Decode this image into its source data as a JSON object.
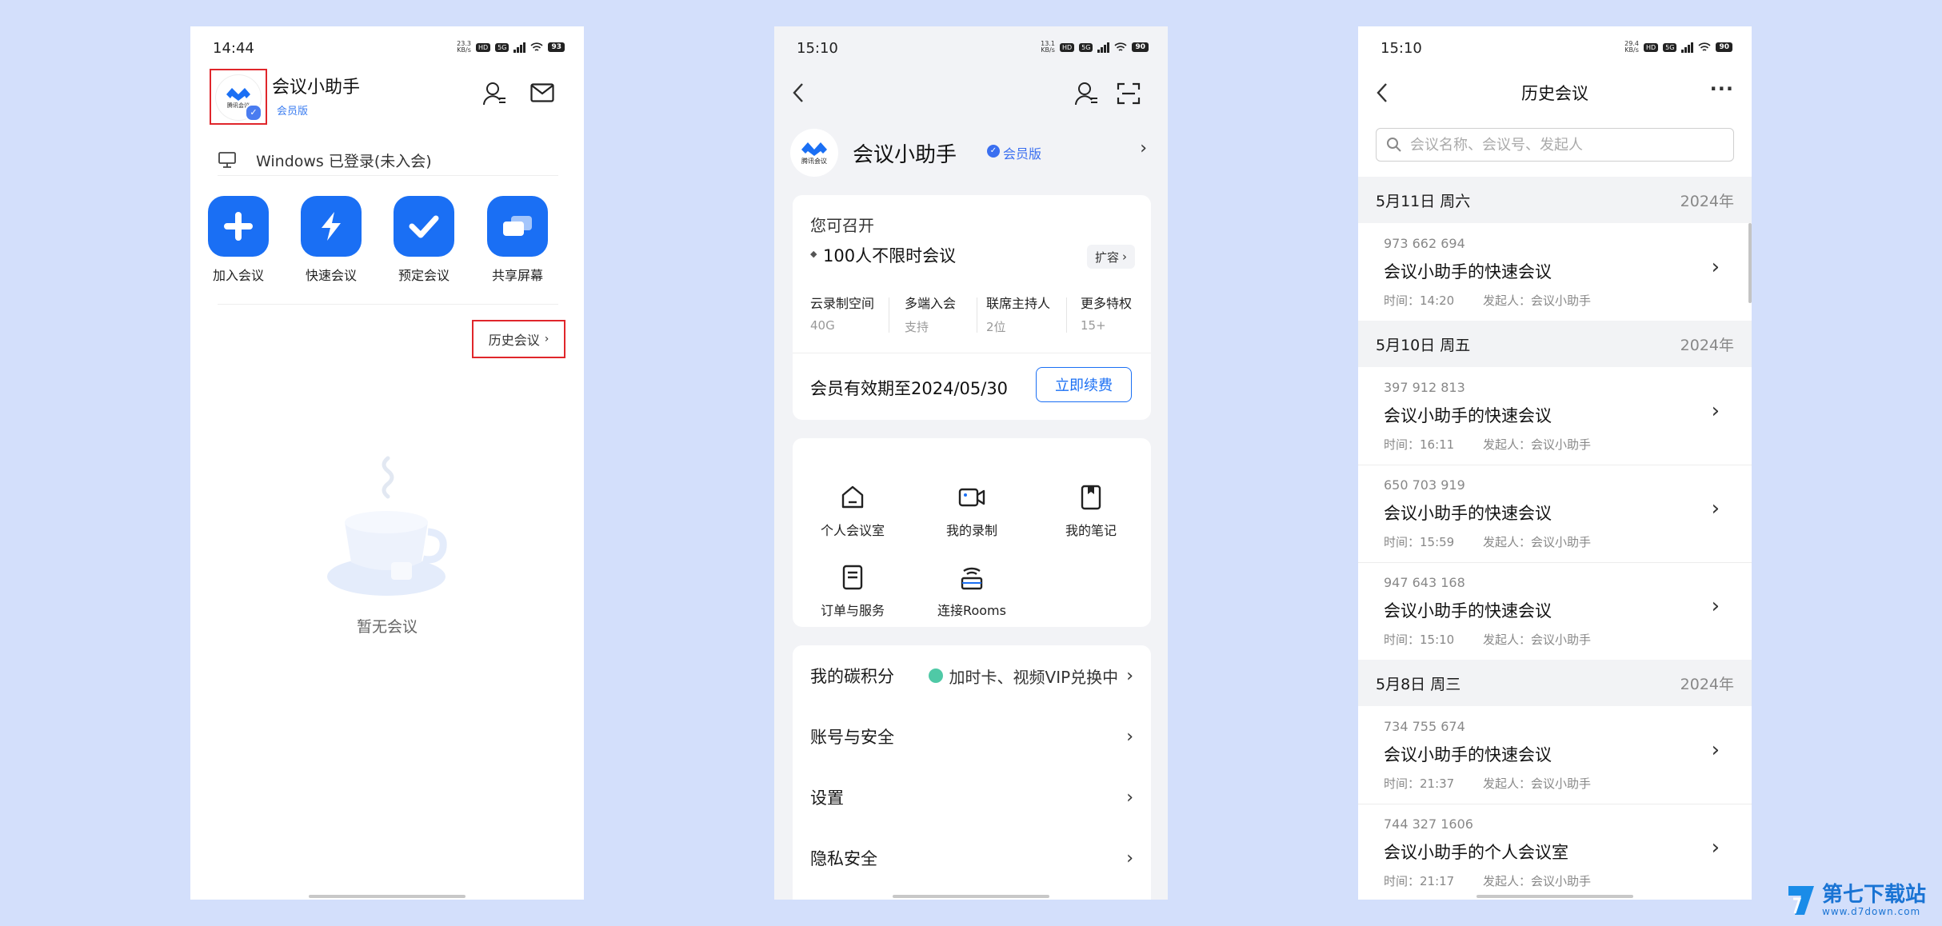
{
  "panel1": {
    "status": {
      "time": "14:44",
      "speed": "23.3\nKB/s",
      "hd": "HD",
      "net": "5G",
      "battery": "93"
    },
    "app_title": "会议小助手",
    "member_badge": "会员版",
    "logo_text": "腾讯会议",
    "device_status": "Windows 已登录(未入会)",
    "quick_actions": [
      {
        "label": "加入会议",
        "icon": "plus-icon"
      },
      {
        "label": "快速会议",
        "icon": "lightning-icon"
      },
      {
        "label": "预定会议",
        "icon": "check-icon"
      },
      {
        "label": "共享屏幕",
        "icon": "share-screen-icon"
      }
    ],
    "history_link": "历史会议",
    "empty_text": "暂无会议"
  },
  "panel2": {
    "status": {
      "time": "15:10",
      "speed": "13.1\nKB/s",
      "hd": "HD",
      "net": "5G",
      "battery": "90"
    },
    "profile_name": "会议小助手",
    "member_badge": "会员版",
    "logo_text": "腾讯会议",
    "plan": {
      "heading": "您可召开",
      "main": "100人不限时会议",
      "expand_btn": "扩容",
      "stats": [
        {
          "k": "云录制空间",
          "v": "40G"
        },
        {
          "k": "多端入会",
          "v": "支持"
        },
        {
          "k": "联席主持人",
          "v": "2位"
        },
        {
          "k": "更多特权",
          "v": "15+"
        }
      ],
      "expiry": "会员有效期至2024/05/30",
      "renew_btn": "立即续费"
    },
    "grid": [
      {
        "label": "个人会议室",
        "icon": "meeting-room-icon"
      },
      {
        "label": "我的录制",
        "icon": "recording-icon"
      },
      {
        "label": "我的笔记",
        "icon": "notes-icon"
      },
      {
        "label": "订单与服务",
        "icon": "order-icon"
      },
      {
        "label": "连接Rooms",
        "icon": "rooms-icon"
      }
    ],
    "menu": [
      {
        "label": "我的碳积分",
        "extra": "加时卡、视频VIP兑换中"
      },
      {
        "label": "账号与安全"
      },
      {
        "label": "设置"
      },
      {
        "label": "隐私安全"
      }
    ]
  },
  "panel3": {
    "status": {
      "time": "15:10",
      "speed": "29.4\nKB/s",
      "hd": "HD",
      "net": "5G",
      "battery": "90"
    },
    "title": "历史会议",
    "more": "···",
    "search_placeholder": "会议名称、会议号、发起人",
    "groups": [
      {
        "date": "5月11日 周六",
        "year": "2024年",
        "meetings": [
          {
            "id": "973 662 694",
            "title": "会议小助手的快速会议",
            "time": "时间：14:20",
            "host": "发起人：会议小助手"
          }
        ]
      },
      {
        "date": "5月10日 周五",
        "year": "2024年",
        "meetings": [
          {
            "id": "397 912 813",
            "title": "会议小助手的快速会议",
            "time": "时间：16:11",
            "host": "发起人：会议小助手"
          },
          {
            "id": "650 703 919",
            "title": "会议小助手的快速会议",
            "time": "时间：15:59",
            "host": "发起人：会议小助手"
          },
          {
            "id": "947 643 168",
            "title": "会议小助手的快速会议",
            "time": "时间：15:10",
            "host": "发起人：会议小助手"
          }
        ]
      },
      {
        "date": "5月8日 周三",
        "year": "2024年",
        "meetings": [
          {
            "id": "734 755 674",
            "title": "会议小助手的快速会议",
            "time": "时间：21:37",
            "host": "发起人：会议小助手"
          },
          {
            "id": "744 327 1606",
            "title": "会议小助手的个人会议室",
            "time": "时间：21:17",
            "host": "发起人：会议小助手"
          }
        ]
      }
    ]
  },
  "watermark": {
    "name": "第七下载站",
    "url": "www.d7down.com"
  },
  "colors": {
    "accent": "#1a6ff4",
    "highlight": "#e0262b",
    "bg": "#d3dffb"
  }
}
